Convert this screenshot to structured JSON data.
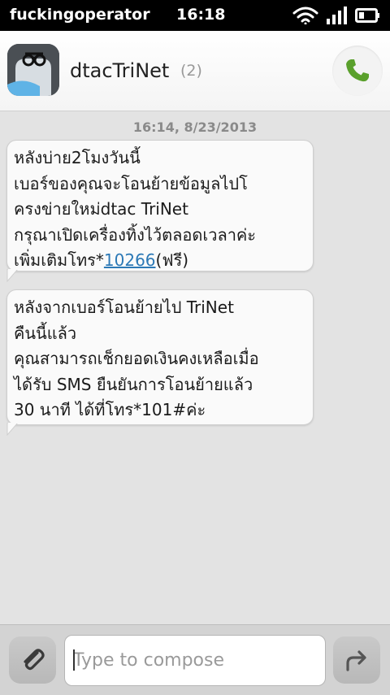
{
  "status_bar": {
    "operator": "fuckingoperator",
    "time": "16:18",
    "icons": [
      "wifi-icon",
      "signal-icon",
      "battery-icon"
    ]
  },
  "header": {
    "contact_name": "dtacTriNet",
    "message_count": "(2)",
    "avatar_icon": "avatar-icon",
    "call_icon": "phone-icon",
    "call_color": "#5aa02c"
  },
  "conversation": {
    "date": "16:14, 8/23/2013",
    "messages": [
      {
        "lines": [
          "หลังบ่าย2โมงวันนี้",
          "เบอร์ของคุณจะโอนย้ายข้อมูลไปโ",
          "ครงข่ายใหม่dtac TriNet",
          "กรุณาเปิดเครื่องทิ้งไว้ตลอดเวลาค่ะ"
        ],
        "last_line_prefix": " เพิ่มเติมโทร*",
        "link": "10266",
        "last_line_suffix": "(ฟรี)"
      },
      {
        "lines": [
          "หลังจากเบอร์โอนย้ายไป TriNet",
          "คืนนี้แล้ว",
          "คุณสามารถเช็กยอดเงินคงเหลือเมื่อ",
          "ได้รับ SMS ยืนยันการโอนย้ายแล้ว",
          "30 นาที ได้ที่โทร*101#ค่ะ"
        ]
      }
    ]
  },
  "compose": {
    "placeholder": "Type to compose",
    "attach_icon": "paperclip-icon",
    "send_icon": "send-arrow-icon"
  },
  "colors": {
    "link": "#2c79b6",
    "background": "#e3e3e3",
    "status_bar": "#000000"
  }
}
